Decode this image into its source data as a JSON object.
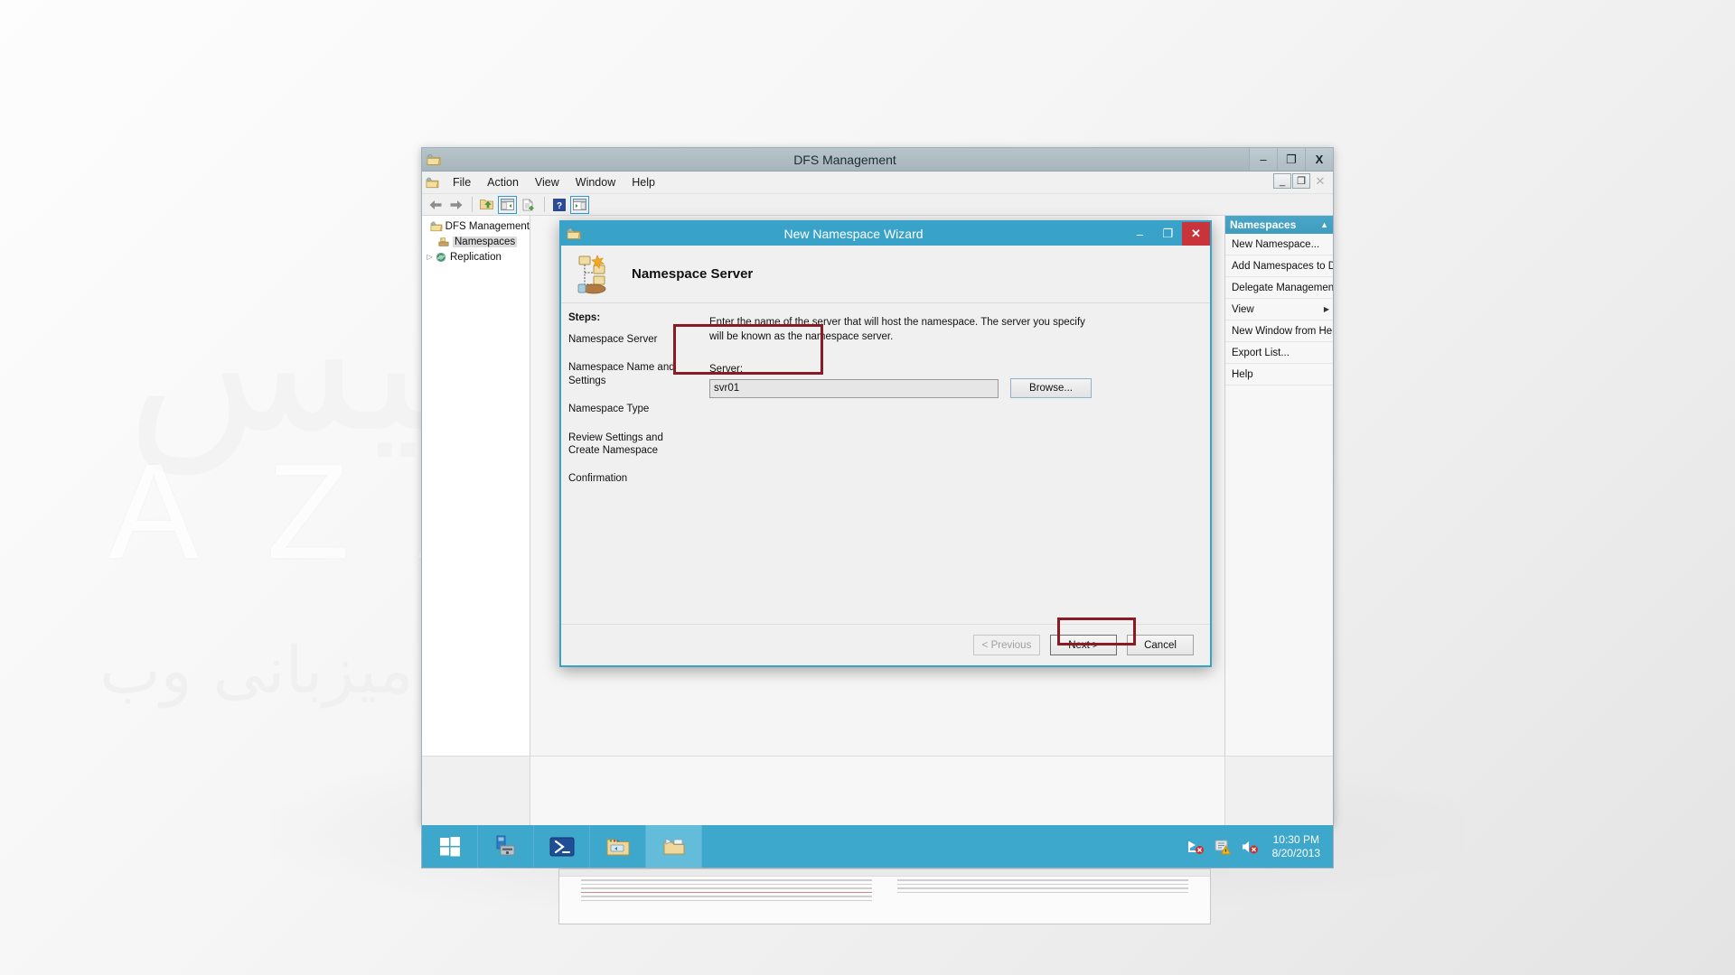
{
  "watermark": {
    "latin": "AZARSYS",
    "arabic_top": "آذرسیس",
    "arabic_bottom": "میزبانی وب"
  },
  "main_window": {
    "title": "DFS Management",
    "icon": "dfs-folder-icon",
    "controls": {
      "minimize": "–",
      "maximize": "❐",
      "close": "X"
    },
    "mdi_controls": {
      "minimize": "_",
      "restore": "❐",
      "close": "✕"
    },
    "menu": [
      {
        "label": "File"
      },
      {
        "label": "Action"
      },
      {
        "label": "View"
      },
      {
        "label": "Window"
      },
      {
        "label": "Help"
      }
    ],
    "toolbar": [
      {
        "name": "back-icon",
        "selected": false
      },
      {
        "name": "forward-icon",
        "selected": false
      },
      {
        "name": "up-folder-icon",
        "selected": false
      },
      {
        "name": "show-hide-tree-icon",
        "selected": true
      },
      {
        "name": "export-list-icon",
        "selected": false
      },
      {
        "name": "help-icon",
        "selected": false
      },
      {
        "name": "show-action-pane-icon",
        "selected": true
      }
    ]
  },
  "tree": {
    "items": [
      {
        "label": "DFS Management",
        "level": 1,
        "expander": "",
        "icon": "dfs-root-icon",
        "selected": false
      },
      {
        "label": "Namespaces",
        "level": 2,
        "expander": "",
        "icon": "namespaces-icon",
        "selected": true
      },
      {
        "label": "Replication",
        "level": 2,
        "expander": "▷",
        "icon": "replication-icon",
        "selected": false
      }
    ]
  },
  "actions_pane": {
    "header": "Namespaces",
    "collapse_glyph": "▲",
    "items": [
      {
        "label": "New Namespace...",
        "submenu": false
      },
      {
        "label": "Add Namespaces to Di...",
        "submenu": false
      },
      {
        "label": "Delegate Management...",
        "submenu": false
      },
      {
        "label": "View",
        "submenu": true,
        "arrow": "▶"
      },
      {
        "label": "New Window from Here",
        "submenu": false
      },
      {
        "label": "Export List...",
        "submenu": false
      },
      {
        "label": "Help",
        "submenu": false
      }
    ]
  },
  "wizard": {
    "title": "New Namespace Wizard",
    "icon": "namespace-wizard-icon",
    "controls": {
      "minimize": "–",
      "maximize": "❐",
      "close": "✕"
    },
    "page_heading": "Namespace Server",
    "steps_label": "Steps:",
    "steps": [
      {
        "label": "Namespace Server",
        "current": true
      },
      {
        "label": "Namespace Name and Settings",
        "current": false
      },
      {
        "label": "Namespace Type",
        "current": false
      },
      {
        "label": "Review Settings and Create Namespace",
        "current": false
      },
      {
        "label": "Confirmation",
        "current": false
      }
    ],
    "intro": "Enter the name of the server that will host the namespace. The server you specify will be known as the namespace server.",
    "server_field": {
      "label": "Server:",
      "value": "svr01",
      "placeholder": ""
    },
    "browse_button": "Browse...",
    "footer": {
      "previous": "< Previous",
      "next": "Next >",
      "cancel": "Cancel"
    }
  },
  "annotations": {
    "highlight_color": "#8c1a24",
    "boxes": [
      "server-field-highlight",
      "next-button-highlight"
    ]
  },
  "taskbar": {
    "items": [
      {
        "name": "start-button-icon"
      },
      {
        "name": "server-manager-icon"
      },
      {
        "name": "powershell-icon"
      },
      {
        "name": "file-explorer-icon"
      },
      {
        "name": "dfs-management-icon",
        "active": true
      }
    ],
    "tray": [
      {
        "name": "network-error-icon"
      },
      {
        "name": "action-center-warning-icon"
      },
      {
        "name": "volume-muted-icon"
      }
    ],
    "clock": {
      "time": "10:30 PM",
      "date": "8/20/2013"
    }
  }
}
